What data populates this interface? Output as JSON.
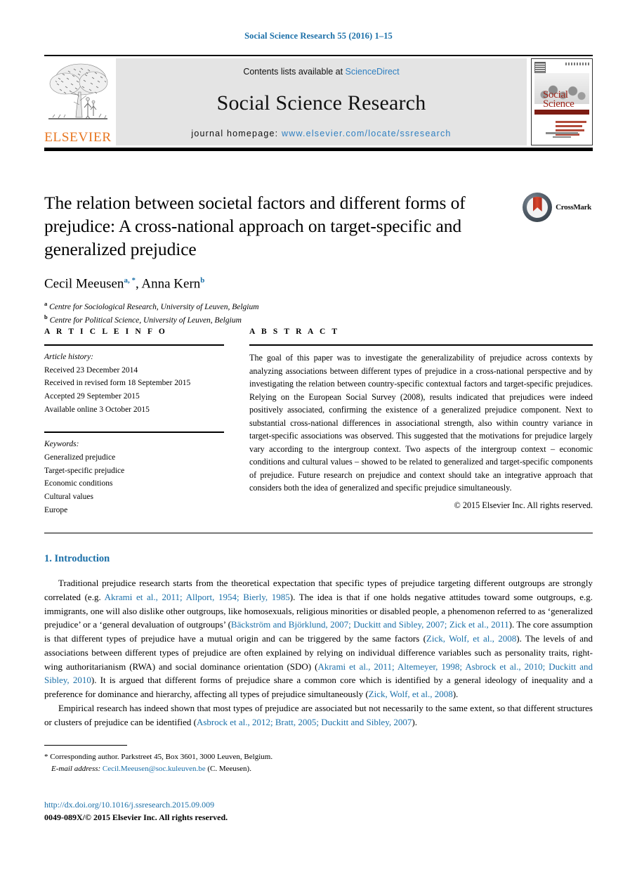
{
  "running_head": "Social Science Research 55 (2016) 1–15",
  "masthead": {
    "contents_prefix": "Contents lists available at ",
    "sciencedirect_link": "ScienceDirect",
    "journal_name": "Social Science Research",
    "homepage_prefix": "journal homepage: ",
    "homepage_url": "www.elsevier.com/locate/ssresearch",
    "publisher_logo_text": "ELSEVIER",
    "cover_title_line1": "Social",
    "cover_title_line2": "Science",
    "link_color": "#2e7fc1",
    "logo_color": "#e87722"
  },
  "article": {
    "title": "The relation between societal factors and different forms of prejudice: A cross-national approach on target-specific and generalized prejudice",
    "crossmark_label": "CrossMark",
    "authors": [
      {
        "name": "Cecil Meeusen",
        "marks": "a, *"
      },
      {
        "name": "Anna Kern",
        "marks": "b"
      }
    ],
    "authors_separator": ", ",
    "affiliations": [
      {
        "mark": "a",
        "text": "Centre for Sociological Research, University of Leuven, Belgium"
      },
      {
        "mark": "b",
        "text": "Centre for Political Science, University of Leuven, Belgium"
      }
    ]
  },
  "article_info": {
    "heading": "A R T I C L E   I N F O",
    "history_label": "Article history:",
    "history": [
      "Received 23 December 2014",
      "Received in revised form 18 September 2015",
      "Accepted 29 September 2015",
      "Available online 3 October 2015"
    ],
    "keywords_label": "Keywords:",
    "keywords": [
      "Generalized prejudice",
      "Target-specific prejudice",
      "Economic conditions",
      "Cultural values",
      "Europe"
    ]
  },
  "abstract": {
    "heading": "A B S T R A C T",
    "text": "The goal of this paper was to investigate the generalizability of prejudice across contexts by analyzing associations between different types of prejudice in a cross-national perspective and by investigating the relation between country-specific contextual factors and target-specific prejudices. Relying on the European Social Survey (2008), results indicated that prejudices were indeed positively associated, confirming the existence of a generalized prejudice component. Next to substantial cross-national differences in associational strength, also within country variance in target-specific associations was observed. This suggested that the motivations for prejudice largely vary according to the intergroup context. Two aspects of the intergroup context – economic conditions and cultural values – showed to be related to generalized and target-specific components of prejudice. Future research on prejudice and context should take an integrative approach that considers both the idea of generalized and specific prejudice simultaneously.",
    "copyright": "© 2015 Elsevier Inc. All rights reserved."
  },
  "body": {
    "section_number_title": "1. Introduction",
    "paragraph_1": {
      "seg_1": "Traditional prejudice research starts from the theoretical expectation that specific types of prejudice targeting different outgroups are strongly correlated (e.g. ",
      "cite_1": "Akrami et al., 2011; Allport, 1954; Bierly, 1985",
      "seg_2": "). The idea is that if one holds negative attitudes toward some outgroups, e.g. immigrants, one will also dislike other outgroups, like homosexuals, religious minorities or disabled people, a phenomenon referred to as ‘generalized prejudice’ or a ‘general devaluation of outgroups’ (",
      "cite_2": "Bäckström and Björklund, 2007; Duckitt and Sibley, 2007; Zick et al., 2011",
      "seg_3": "). The core assumption is that different types of prejudice have a mutual origin and can be triggered by the same factors (",
      "cite_3": "Zick, Wolf, et al., 2008",
      "seg_4": "). The levels of and associations between different types of prejudice are often explained by relying on individual difference variables such as personality traits, right-wing authoritarianism (RWA) and social dominance orientation (SDO) (",
      "cite_4": "Akrami et al., 2011; Altemeyer, 1998; Asbrock et al., 2010; Duckitt and Sibley, 2010",
      "seg_5": "). It is argued that different forms of prejudice share a common core which is identified by a general ideology of inequality and a preference for dominance and hierarchy, affecting all types of prejudice simultaneously (",
      "cite_5": "Zick, Wolf, et al., 2008",
      "seg_6": ")."
    },
    "paragraph_2": {
      "seg_1": "Empirical research has indeed shown that most types of prejudice are associated but not necessarily to the same extent, so that different structures or clusters of prejudice can be identified (",
      "cite_1": "Asbrock et al., 2012; Bratt, 2005; Duckitt and Sibley, 2007",
      "seg_2": ")."
    }
  },
  "footer": {
    "corresponding_marker": "*",
    "corresponding_text": " Corresponding author. Parkstreet 45, Box 3601, 3000 Leuven, Belgium.",
    "email_label": "E-mail address:",
    "email": "Cecil.Meeusen@soc.kuleuven.be",
    "email_suffix": " (C. Meeusen).",
    "doi": "http://dx.doi.org/10.1016/j.ssresearch.2015.09.009",
    "issn_copyright": "0049-089X/© 2015 Elsevier Inc. All rights reserved."
  }
}
